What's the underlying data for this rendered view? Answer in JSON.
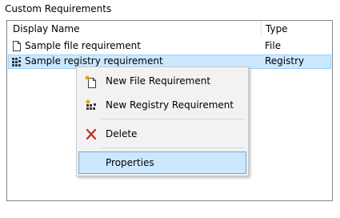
{
  "group": {
    "title": "Custom Requirements"
  },
  "list": {
    "columns": {
      "display_name": "Display Name",
      "type": "Type"
    },
    "rows": [
      {
        "name": "Sample file requirement",
        "type": "File",
        "icon": "file-icon"
      },
      {
        "name": "Sample registry requirement",
        "type": "Registry",
        "icon": "registry-icon",
        "selected": true
      }
    ]
  },
  "context_menu": {
    "items": [
      {
        "label": "New File Requirement",
        "icon": "new-file-icon"
      },
      {
        "label": "New Registry Requirement",
        "icon": "new-registry-icon"
      },
      {
        "label": "Delete",
        "icon": "delete-x-icon"
      },
      {
        "label": "Properties",
        "highlighted": true
      }
    ]
  },
  "colors": {
    "selection_bg": "#cce8ff",
    "selection_border": "#99d1ff",
    "menu_bg": "#f2f2f2",
    "delete_red": "#c42b1c"
  }
}
